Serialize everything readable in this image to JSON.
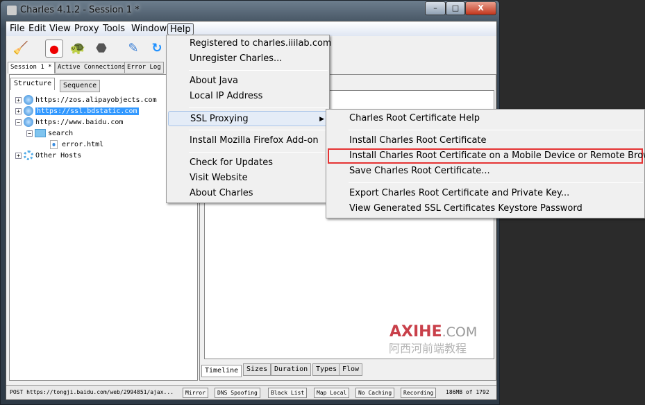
{
  "window": {
    "title": "Charles 4.1.2 - Session 1 *",
    "controls": [
      "–",
      "□",
      "X"
    ]
  },
  "menubar": [
    "File",
    "Edit",
    "View",
    "Proxy",
    "Tools",
    "Window",
    "Help"
  ],
  "session_tabs": [
    "Session 1 *",
    "Active Connections",
    "Error Log"
  ],
  "left_tabs": [
    "Structure",
    "Sequence"
  ],
  "tree": [
    {
      "label": "https://zos.alipayobjects.com",
      "expander": "+"
    },
    {
      "label": "https://ssl.bdstatic.com",
      "expander": "+",
      "selected": true
    },
    {
      "label": "https://www.baidu.com",
      "expander": "−"
    },
    {
      "label": "search",
      "expander": "−"
    },
    {
      "label": "error.html"
    },
    {
      "label": "Other Hosts",
      "expander": "+"
    }
  ],
  "bottom_tabs": [
    "Timeline",
    "Sizes",
    "Duration",
    "Types",
    "Flow"
  ],
  "status": {
    "request": "POST https://tongji.baidu.com/web/2994851/ajax...",
    "buttons": [
      "Mirror",
      "DNS Spoofing",
      "Black List",
      "Map Local",
      "No Caching",
      "Recording"
    ],
    "memory": "186MB of 1792"
  },
  "help_menu": [
    "Registered to charles.iiilab.com",
    "Unregister Charles...",
    "About Java",
    "Local IP Address",
    "SSL Proxying",
    "Install Mozilla Firefox Add-on",
    "Check for Updates",
    "Visit Website",
    "About Charles"
  ],
  "ssl_submenu": [
    "Charles Root Certificate Help",
    "Install Charles Root Certificate",
    "Install Charles Root Certificate on a Mobile Device or Remote Browser",
    "Save Charles Root Certificate...",
    "Export Charles Root Certificate and Private Key...",
    "View Generated SSL Certificates Keystore Password"
  ],
  "watermark": {
    "brand": "AXIHE",
    "suffix": ".COM",
    "cn": "阿西河前端教程"
  },
  "colors": {
    "selection": "#3399ff",
    "highlight_border": "#e53333",
    "watermark": "#c9404a"
  }
}
